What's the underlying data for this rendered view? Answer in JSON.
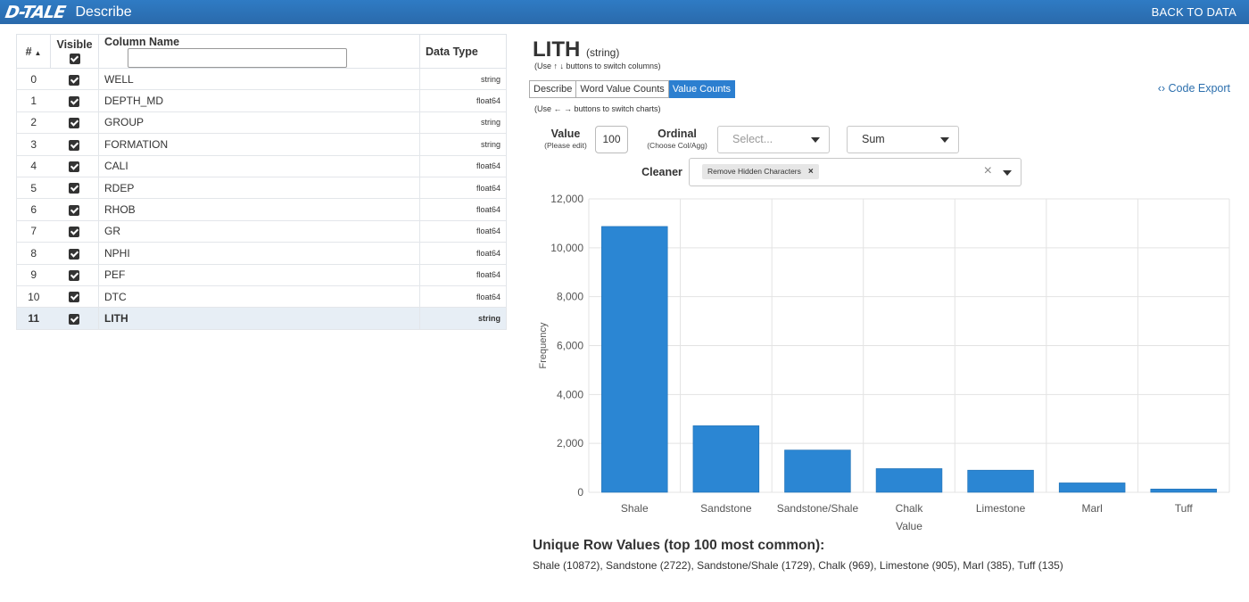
{
  "header": {
    "logo": "D-TALE",
    "title": "Describe",
    "back_label": "BACK TO DATA"
  },
  "table": {
    "headers": {
      "index": "#",
      "visible": "Visible",
      "name": "Column Name",
      "dtype": "Data Type"
    },
    "rows": [
      {
        "idx": "0",
        "name": "WELL",
        "dtype": "string",
        "visible": true
      },
      {
        "idx": "1",
        "name": "DEPTH_MD",
        "dtype": "float64",
        "visible": true
      },
      {
        "idx": "2",
        "name": "GROUP",
        "dtype": "string",
        "visible": true
      },
      {
        "idx": "3",
        "name": "FORMATION",
        "dtype": "string",
        "visible": true
      },
      {
        "idx": "4",
        "name": "CALI",
        "dtype": "float64",
        "visible": true
      },
      {
        "idx": "5",
        "name": "RDEP",
        "dtype": "float64",
        "visible": true
      },
      {
        "idx": "6",
        "name": "RHOB",
        "dtype": "float64",
        "visible": true
      },
      {
        "idx": "7",
        "name": "GR",
        "dtype": "float64",
        "visible": true
      },
      {
        "idx": "8",
        "name": "NPHI",
        "dtype": "float64",
        "visible": true
      },
      {
        "idx": "9",
        "name": "PEF",
        "dtype": "float64",
        "visible": true
      },
      {
        "idx": "10",
        "name": "DTC",
        "dtype": "float64",
        "visible": true
      },
      {
        "idx": "11",
        "name": "LITH",
        "dtype": "string",
        "visible": true,
        "selected": true
      }
    ]
  },
  "details": {
    "column": "LITH",
    "dtype": "(string)",
    "col_hint": "(Use ↑ ↓ buttons to switch columns)",
    "tabs": [
      "Describe",
      "Word Value Counts",
      "Value Counts"
    ],
    "active_tab": "Value Counts",
    "chart_hint": "(Use ← → buttons to switch charts)",
    "code_export": "Code Export",
    "value_label": "Value",
    "value_sub": "(Please edit)",
    "value": "100",
    "ordinal_label": "Ordinal",
    "ordinal_sub": "(Choose Col/Agg)",
    "ordinal_placeholder": "Select...",
    "agg_value": "Sum",
    "cleaner_label": "Cleaner",
    "cleaner_chip": "Remove Hidden Characters",
    "unique_title": "Unique Row Values (top 100 most common):",
    "unique_text": "Shale (10872), Sandstone (2722), Sandstone/Shale (1729), Chalk (969), Limestone (905), Marl (385), Tuff (135)"
  },
  "colors": {
    "header": "#2c72b8",
    "bar": "#2b86d3",
    "accent": "#2c7fd0"
  },
  "chart_data": {
    "type": "bar",
    "categories": [
      "Shale",
      "Sandstone",
      "Sandstone/Shale",
      "Chalk",
      "Limestone",
      "Marl",
      "Tuff"
    ],
    "values": [
      10872,
      2722,
      1729,
      969,
      905,
      385,
      135
    ],
    "xlabel": "Value",
    "ylabel": "Frequency",
    "ylim": [
      0,
      12000
    ],
    "yticks": [
      "0",
      "2,000",
      "4,000",
      "6,000",
      "8,000",
      "10,000",
      "12,000"
    ],
    "grid": true
  }
}
